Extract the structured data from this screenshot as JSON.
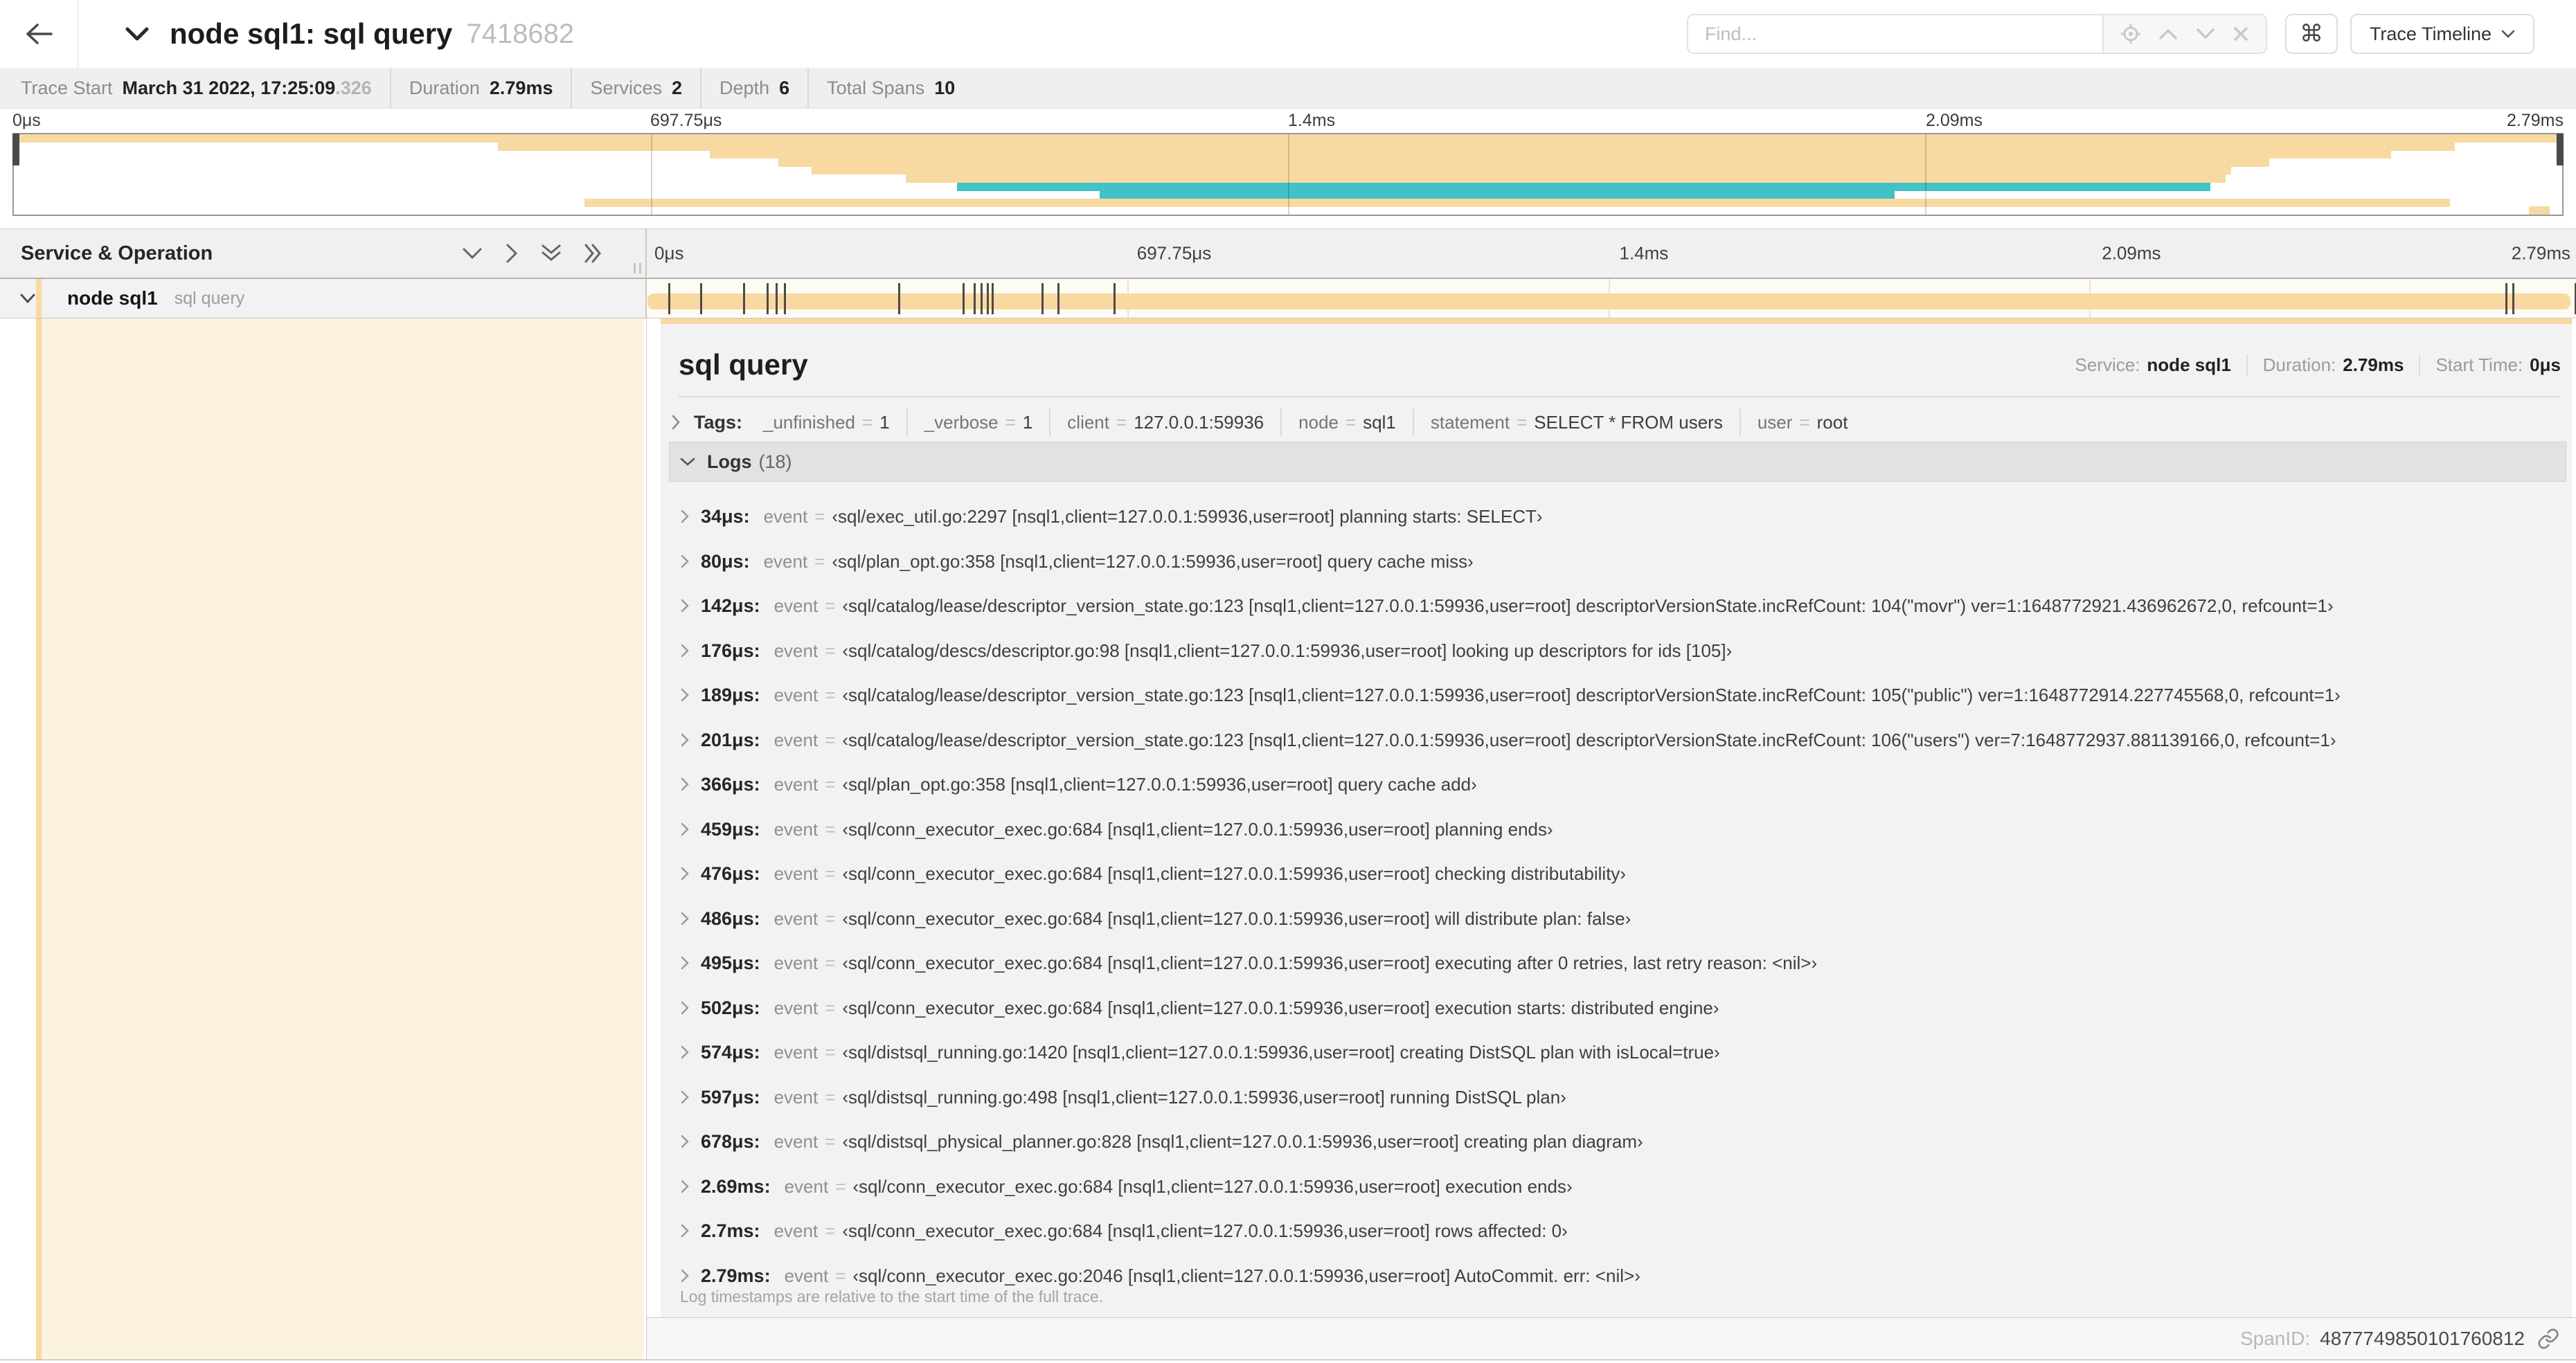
{
  "header": {
    "title": "node sql1: sql query",
    "trace_id": "7418682",
    "find": {
      "placeholder": "Find..."
    },
    "shortcut_glyph": "⌘",
    "view_selector": {
      "label": "Trace Timeline"
    }
  },
  "stats": {
    "items": [
      {
        "label": "Trace Start",
        "value": "March 31 2022, 17:25:09",
        "suffix": ".326"
      },
      {
        "label": "Duration",
        "value": "2.79ms",
        "suffix": ""
      },
      {
        "label": "Services",
        "value": "2",
        "suffix": ""
      },
      {
        "label": "Depth",
        "value": "6",
        "suffix": ""
      },
      {
        "label": "Total Spans",
        "value": "10",
        "suffix": ""
      }
    ]
  },
  "minimap": {
    "axis_labels": [
      "0μs",
      "697.75μs",
      "1.4ms",
      "2.09ms",
      "2.79ms"
    ],
    "rows": [
      {
        "row": 1,
        "start": 0.0,
        "end": 1.0,
        "color": "tan"
      },
      {
        "row": 2,
        "start": 0.19,
        "end": 0.958,
        "color": "tan"
      },
      {
        "row": 3,
        "start": 0.273,
        "end": 0.933,
        "color": "tan"
      },
      {
        "row": 4,
        "start": 0.3,
        "end": 0.885,
        "color": "tan"
      },
      {
        "row": 5,
        "start": 0.313,
        "end": 0.87,
        "color": "tan"
      },
      {
        "row": 6,
        "start": 0.35,
        "end": 0.868,
        "color": "tan"
      },
      {
        "row": 7,
        "start": 0.37,
        "end": 0.862,
        "color": "teal"
      },
      {
        "row": 8,
        "start": 0.426,
        "end": 0.738,
        "color": "teal"
      },
      {
        "row": 9,
        "start": 0.224,
        "end": 0.956,
        "color": "tan"
      },
      {
        "row": 10,
        "start": 0.987,
        "end": 0.995,
        "color": "tan"
      }
    ]
  },
  "timeline": {
    "header_label": "Service & Operation",
    "axis_labels": [
      "0μs",
      "697.75μs",
      "1.4ms",
      "2.09ms",
      "2.79ms"
    ],
    "span_row": {
      "service": "node sql1",
      "operation": "sql query",
      "duration_us": 2790,
      "log_marker_times_us": [
        34,
        80,
        142,
        176,
        189,
        201,
        366,
        459,
        476,
        486,
        495,
        502,
        574,
        597,
        678,
        2690,
        2700,
        2790
      ]
    }
  },
  "detail": {
    "operation": "sql query",
    "meta": [
      {
        "label": "Service:",
        "value": "node sql1"
      },
      {
        "label": "Duration:",
        "value": "2.79ms"
      },
      {
        "label": "Start Time:",
        "value": "0μs"
      }
    ],
    "tags": {
      "label": "Tags:",
      "items": [
        {
          "key": "_unfinished",
          "value": "1"
        },
        {
          "key": "_verbose",
          "value": "1"
        },
        {
          "key": "client",
          "value": "127.0.0.1:59936"
        },
        {
          "key": "node",
          "value": "sql1"
        },
        {
          "key": "statement",
          "value": "SELECT * FROM users"
        },
        {
          "key": "user",
          "value": "root"
        }
      ]
    },
    "logs": {
      "label": "Logs",
      "count": "(18)",
      "field_label": "event",
      "entries": [
        {
          "time": "34μs:",
          "value": "‹sql/exec_util.go:2297 [nsql1,client=127.0.0.1:59936,user=root] planning starts: SELECT›"
        },
        {
          "time": "80μs:",
          "value": "‹sql/plan_opt.go:358 [nsql1,client=127.0.0.1:59936,user=root] query cache miss›"
        },
        {
          "time": "142μs:",
          "value": "‹sql/catalog/lease/descriptor_version_state.go:123 [nsql1,client=127.0.0.1:59936,user=root] descriptorVersionState.incRefCount: 104(\"movr\") ver=1:1648772921.436962672,0, refcount=1›"
        },
        {
          "time": "176μs:",
          "value": "‹sql/catalog/descs/descriptor.go:98 [nsql1,client=127.0.0.1:59936,user=root] looking up descriptors for ids [105]›"
        },
        {
          "time": "189μs:",
          "value": "‹sql/catalog/lease/descriptor_version_state.go:123 [nsql1,client=127.0.0.1:59936,user=root] descriptorVersionState.incRefCount: 105(\"public\") ver=1:1648772914.227745568,0, refcount=1›"
        },
        {
          "time": "201μs:",
          "value": "‹sql/catalog/lease/descriptor_version_state.go:123 [nsql1,client=127.0.0.1:59936,user=root] descriptorVersionState.incRefCount: 106(\"users\") ver=7:1648772937.881139166,0, refcount=1›"
        },
        {
          "time": "366μs:",
          "value": "‹sql/plan_opt.go:358 [nsql1,client=127.0.0.1:59936,user=root] query cache add›"
        },
        {
          "time": "459μs:",
          "value": "‹sql/conn_executor_exec.go:684 [nsql1,client=127.0.0.1:59936,user=root] planning ends›"
        },
        {
          "time": "476μs:",
          "value": "‹sql/conn_executor_exec.go:684 [nsql1,client=127.0.0.1:59936,user=root] checking distributability›"
        },
        {
          "time": "486μs:",
          "value": "‹sql/conn_executor_exec.go:684 [nsql1,client=127.0.0.1:59936,user=root] will distribute plan: false›"
        },
        {
          "time": "495μs:",
          "value": "‹sql/conn_executor_exec.go:684 [nsql1,client=127.0.0.1:59936,user=root] executing after 0 retries, last retry reason: <nil>›"
        },
        {
          "time": "502μs:",
          "value": "‹sql/conn_executor_exec.go:684 [nsql1,client=127.0.0.1:59936,user=root] execution starts: distributed engine›"
        },
        {
          "time": "574μs:",
          "value": "‹sql/distsql_running.go:1420 [nsql1,client=127.0.0.1:59936,user=root] creating DistSQL plan with isLocal=true›"
        },
        {
          "time": "597μs:",
          "value": "‹sql/distsql_running.go:498 [nsql1,client=127.0.0.1:59936,user=root] running DistSQL plan›"
        },
        {
          "time": "678μs:",
          "value": "‹sql/distsql_physical_planner.go:828 [nsql1,client=127.0.0.1:59936,user=root] creating plan diagram›"
        },
        {
          "time": "2.69ms:",
          "value": "‹sql/conn_executor_exec.go:684 [nsql1,client=127.0.0.1:59936,user=root] execution ends›"
        },
        {
          "time": "2.7ms:",
          "value": "‹sql/conn_executor_exec.go:684 [nsql1,client=127.0.0.1:59936,user=root] rows affected: 0›"
        },
        {
          "time": "2.79ms:",
          "value": "‹sql/conn_executor_exec.go:2046 [nsql1,client=127.0.0.1:59936,user=root] AutoCommit. err: <nil>›"
        }
      ],
      "footnote": "Log timestamps are relative to the start time of the full trace."
    },
    "footer": {
      "label": "SpanID:",
      "value": "4877749850101760812"
    }
  },
  "symbols": {
    "eq": "="
  },
  "colors": {
    "tan": "#f8d9a1",
    "teal": "#42c2c6",
    "cream": "#fbf3e0",
    "tick": "#4f4b44"
  }
}
